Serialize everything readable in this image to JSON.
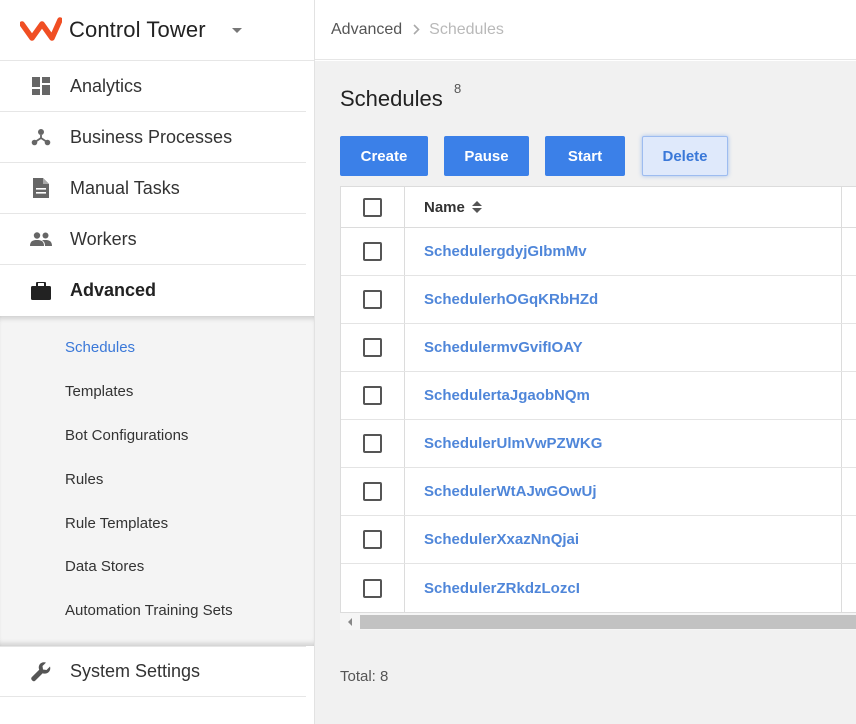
{
  "app": {
    "title": "Control Tower",
    "accent": "#f04e23"
  },
  "sidebar": {
    "items": [
      {
        "label": "Analytics",
        "icon": "dashboard-icon"
      },
      {
        "label": "Business Processes",
        "icon": "process-icon"
      },
      {
        "label": "Manual Tasks",
        "icon": "document-icon"
      },
      {
        "label": "Workers",
        "icon": "people-icon"
      },
      {
        "label": "Advanced",
        "icon": "briefcase-icon",
        "active": true
      }
    ],
    "submenu": [
      {
        "label": "Schedules",
        "active": true
      },
      {
        "label": "Templates"
      },
      {
        "label": "Bot Configurations"
      },
      {
        "label": "Rules"
      },
      {
        "label": "Rule Templates"
      },
      {
        "label": "Data Stores"
      },
      {
        "label": "Automation Training Sets"
      }
    ],
    "bottom": {
      "label": "System Settings",
      "icon": "wrench-icon"
    }
  },
  "breadcrumb": {
    "parent": "Advanced",
    "current": "Schedules"
  },
  "page": {
    "title": "Schedules",
    "count": "8",
    "total_label": "Total: 8"
  },
  "toolbar": {
    "create": "Create",
    "pause": "Pause",
    "start": "Start",
    "delete": "Delete",
    "primary_color": "#3b80e8"
  },
  "table": {
    "header_name": "Name",
    "rows": [
      "SchedulergdyjGIbmMv",
      "SchedulerhOGqKRbHZd",
      "SchedulermvGvifIOAY",
      "SchedulertaJgaobNQm",
      "SchedulerUlmVwPZWKG",
      "SchedulerWtAJwGOwUj",
      "SchedulerXxazNnQjai",
      "SchedulerZRkdzLozcI"
    ]
  }
}
